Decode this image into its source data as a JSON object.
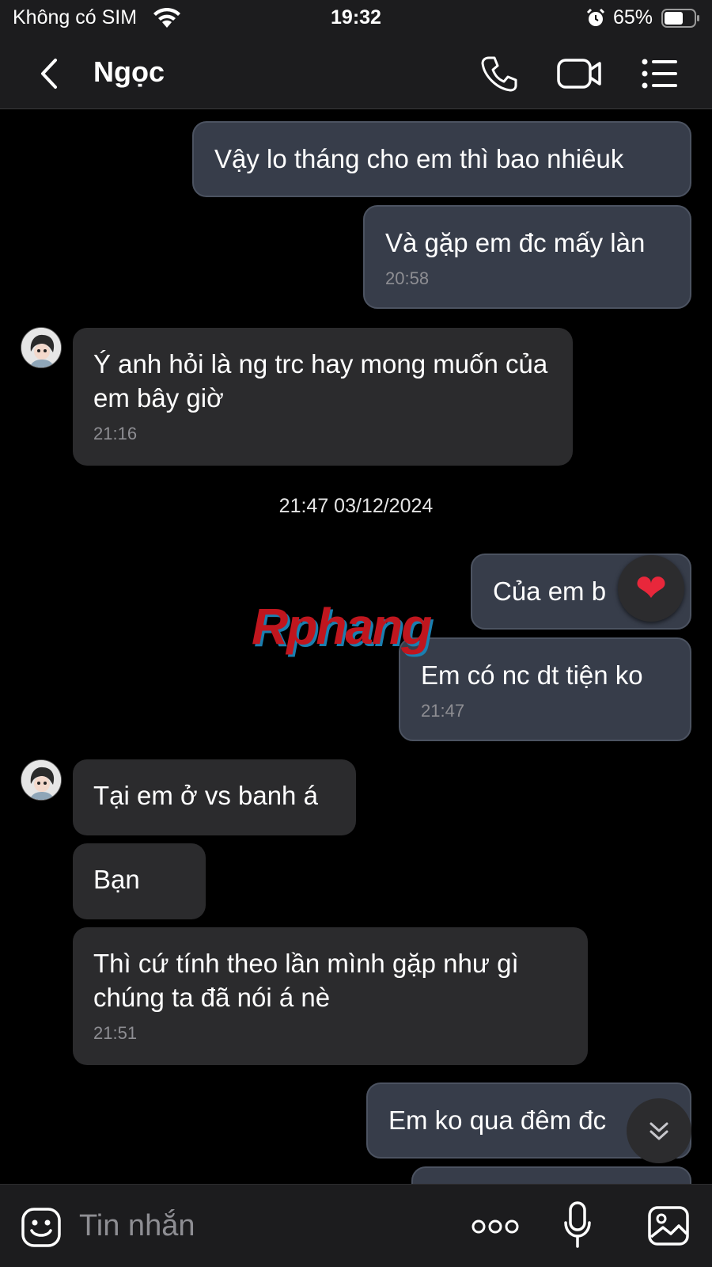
{
  "status_bar": {
    "carrier": "Không có SIM",
    "time": "19:32",
    "battery_percent": "65%",
    "battery_level": 0.65,
    "icons": [
      "wifi-icon",
      "alarm-icon",
      "battery-icon"
    ]
  },
  "header": {
    "contact_name": "Ngọc",
    "icons": [
      "back-icon",
      "phone-icon",
      "video-camera-icon",
      "list-menu-icon"
    ]
  },
  "messages": [
    {
      "direction": "out",
      "text": "Vậy lo tháng cho em thì bao nhiêuk",
      "time": ""
    },
    {
      "direction": "out",
      "text": "Và gặp em đc mấy làn",
      "time": "20:58"
    },
    {
      "direction": "in",
      "text": "Ý anh hỏi là ng trc hay mong muốn của em bây giờ",
      "time": "21:16"
    },
    {
      "direction": "out",
      "text": "Của em b",
      "time": "",
      "reaction": "❤"
    },
    {
      "direction": "out",
      "text": "Em có nc dt tiện ko",
      "time": "21:47"
    },
    {
      "direction": "in",
      "text": "Tại em ở vs banh á",
      "time": ""
    },
    {
      "direction": "in",
      "text": "Bạn",
      "time": ""
    },
    {
      "direction": "in",
      "text": "Thì cứ tính theo lần mình gặp như gì chúng ta đã nói á nè",
      "time": "21:51"
    },
    {
      "direction": "out",
      "text": "Em ko qua đêm đc",
      "time": ""
    }
  ],
  "date_separator": "21:47 03/12/2024",
  "watermark": "Rphang",
  "composer": {
    "placeholder": "Tin nhắn",
    "icons": [
      "emoji-icon",
      "more-dots-icon",
      "microphone-icon",
      "image-icon"
    ]
  },
  "colors": {
    "background": "#000000",
    "bar": "#1c1c1e",
    "outgoing_bubble": "#373d4a",
    "incoming_bubble": "#2b2b2d",
    "timestamp": "#8e8e93",
    "reaction_heart": "#e8273b"
  }
}
